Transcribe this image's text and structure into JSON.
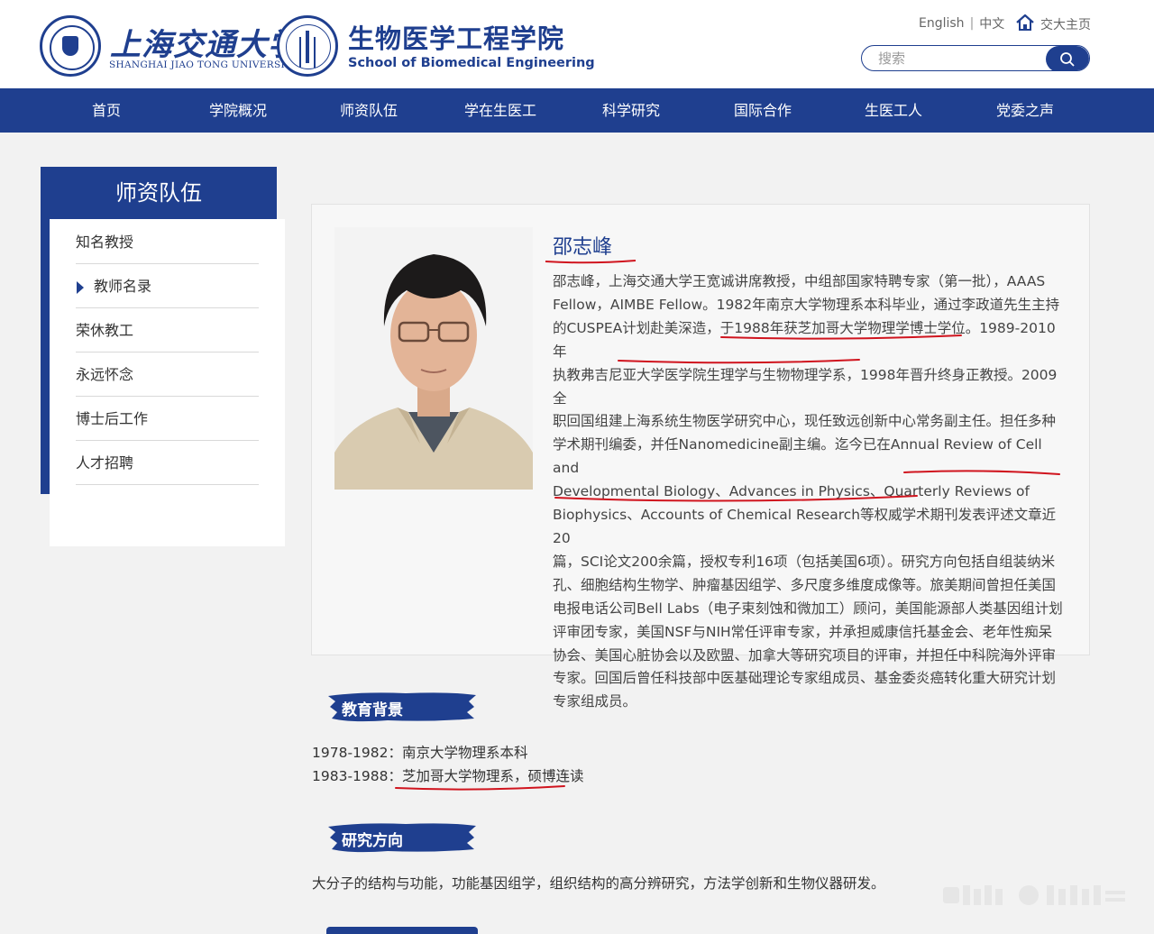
{
  "header": {
    "university_cn": "上海交通大学",
    "university_en": "SHANGHAI JIAO TONG UNIVERSITY",
    "school_cn": "生物医学工程学院",
    "school_en": "School of Biomedical Engineering",
    "lang_en": "English",
    "lang_separator": "|",
    "lang_cn": "中文",
    "home_link": "交大主页",
    "search_placeholder": "搜索"
  },
  "nav": [
    "首页",
    "学院概况",
    "师资队伍",
    "学在生医工",
    "科学研究",
    "国际合作",
    "生医工人",
    "党委之声"
  ],
  "sidebar": {
    "title": "师资队伍",
    "items": [
      {
        "label": "知名教授",
        "active": false
      },
      {
        "label": "教师名录",
        "active": true
      },
      {
        "label": "荣休教工",
        "active": false
      },
      {
        "label": "永远怀念",
        "active": false
      },
      {
        "label": "博士后工作",
        "active": false
      },
      {
        "label": "人才招聘",
        "active": false
      }
    ]
  },
  "profile": {
    "name": "邵志峰",
    "bio_lines": [
      "邵志峰，上海交通大学王宽诚讲席教授，中组部国家特聘专家（第一批），AAAS",
      "Fellow，AIMBE Fellow。1982年南京大学物理系本科毕业，通过李政道先生主持",
      "的CUSPEA计划赴美深造，于1988年获芝加哥大学物理学博士学位。1989-2010年",
      "执教弗吉尼亚大学医学院生理学与生物物理学系，1998年晋升终身正教授。2009全",
      "职回国组建上海系统生物医学研究中心，现任致远创新中心常务副主任。担任多种",
      "学术期刊编委，并任Nanomedicine副主编。迄今已在Annual Review of Cell and",
      "Developmental Biology、Advances in Physics、Quarterly Reviews of",
      "Biophysics、Accounts of Chemical Research等权威学术期刊发表评述文章近20",
      "篇，SCI论文200余篇，授权专利16项（包括美国6项）。研究方向包括自组装纳米",
      "孔、细胞结构生物学、肿瘤基因组学、多尺度多维度成像等。旅美期间曾担任美国",
      "电报电话公司Bell Labs（电子束刻蚀和微加工）顾问，美国能源部人类基因组计划",
      "评审团专家，美国NSF与NIH常任评审专家，并承担威康信托基金会、老年性痴呆",
      "协会、美国心脏协会以及欧盟、加拿大等研究项目的评审，并担任中科院海外评审",
      "专家。回国后曾任科技部中医基础理论专家组成员、基金委炎癌转化重大研究计划",
      "专家组成员。"
    ]
  },
  "education": {
    "title": "教育背景",
    "entries": [
      "1978-1982：南京大学物理系本科",
      "1983-1988：芝加哥大学物理系，硕博连读"
    ]
  },
  "research": {
    "title": "研究方向",
    "text": "大分子的结构与功能，功能基因组学，组织结构的高分辨研究，方法学创新和生物仪器研发。"
  },
  "colors": {
    "brand_blue": "#1f3f8f",
    "annotation_red": "#d0141e",
    "page_bg": "#f2f2f2"
  }
}
